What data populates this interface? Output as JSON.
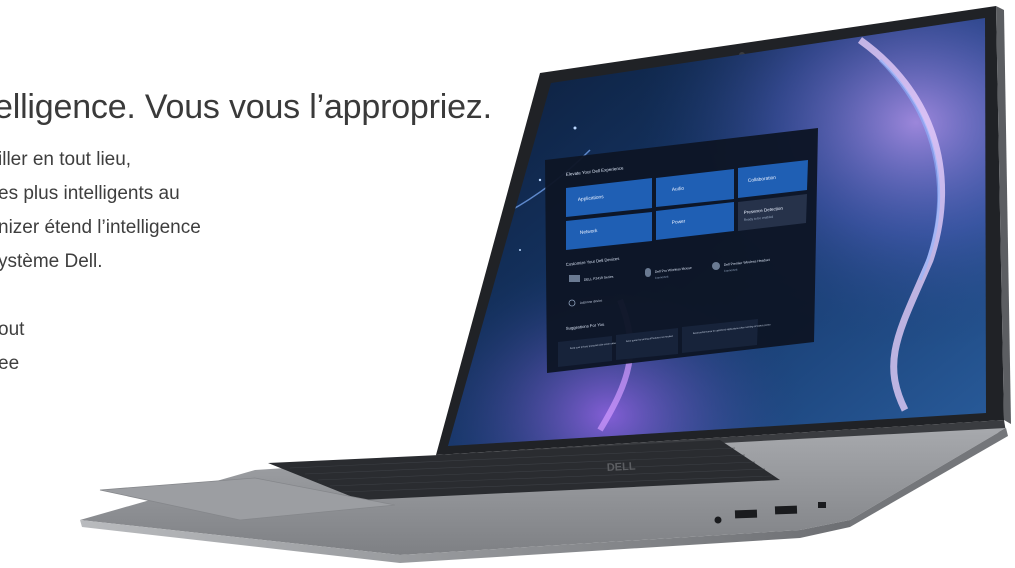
{
  "hero": {
    "headline": "elligence. Vous vous l’appropriez.",
    "lines": [
      "iller en tout lieu,",
      "es plus intelligents au",
      "nizer étend l’intelligence",
      "ystème Dell."
    ],
    "lines2": [
      "out",
      "ee"
    ]
  },
  "laptop": {
    "brand": "DELL",
    "app": {
      "title": "Elevate Your Dell Experience",
      "tiles": [
        "Applications",
        "Audio",
        "Collaboration",
        "Network",
        "Power",
        "Presence Detection"
      ],
      "presence_sub": "Ready to be enabled",
      "customize_title": "Customize Your Dell Devices",
      "devices": [
        {
          "name": "DELL P2419 Series",
          "sub": ""
        },
        {
          "name": "Dell Pro Wireless Mouse",
          "sub": "Connected"
        },
        {
          "name": "Dell Premier Wireless Headset",
          "sub": "Connected"
        }
      ],
      "add_device": "Add new device",
      "suggestions_title": "Suggestions For You",
      "suggestions": [
        "Keep your privacy protected with screen detection features",
        "Save power by turning off features not needed",
        "Boost performance for optimized applications when running on battery power"
      ]
    },
    "colors": {
      "tile": "#1f5fb4",
      "panel": "#0d1626",
      "chassis": "#8d8f93"
    }
  }
}
